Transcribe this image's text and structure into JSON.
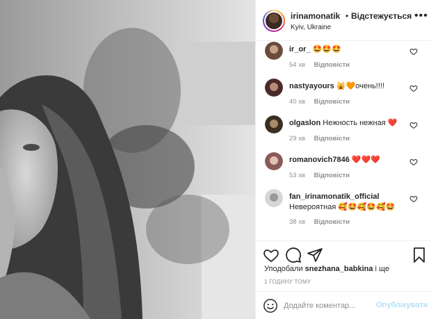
{
  "post": {
    "header": {
      "username": "irinamonatik",
      "separator": "•",
      "follow_status": "Відстежується",
      "location": "Kyiv, Ukraine",
      "more_icon": "more-horizontal-icon"
    },
    "comments": [
      {
        "username": "ir_or_",
        "text": "🤩🤩🤩",
        "ago": "54 хв",
        "reply": "Відповісти"
      },
      {
        "username": "nastyayours",
        "text": "🙀🧡очень!!!!",
        "ago": "40 хв",
        "reply": "Відповісти"
      },
      {
        "username": "olgaslon",
        "text": "Нежность нежная ❤️",
        "ago": "29 хв",
        "reply": "Відповісти"
      },
      {
        "username": "romanovich7846",
        "text": "❤️❤️❤️",
        "ago": "53 хв",
        "reply": "Відповісти"
      },
      {
        "username": "fan_irinamonatik_official",
        "text": "Невероятная 🥰🤩🥰🤩🥰🤩",
        "ago": "38 хв",
        "reply": "Відповісти"
      }
    ],
    "actions": {
      "like_icon": "heart-icon",
      "comment_icon": "comment-icon",
      "share_icon": "send-icon",
      "save_icon": "bookmark-icon"
    },
    "likes": {
      "prefix": "Уподобали",
      "user": "snezhana_babkina",
      "suffix": "і ще"
    },
    "time_posted": "1 ГОДИНУ ТОМУ",
    "add_comment": {
      "placeholder": "Додайте коментар...",
      "publish_label": "Опублікувати",
      "emoji_icon": "smiley-icon"
    }
  }
}
